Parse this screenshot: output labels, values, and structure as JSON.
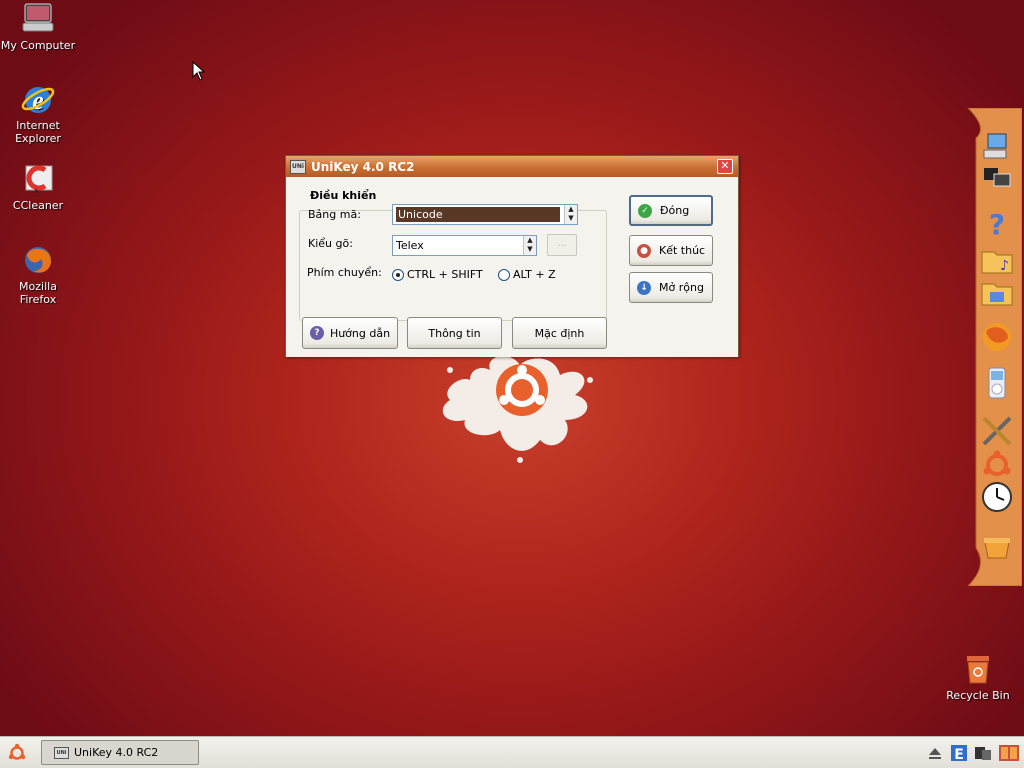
{
  "desktop": {
    "icons": [
      {
        "label_line1": "My Computer",
        "label_line2": ""
      },
      {
        "label_line1": "Internet",
        "label_line2": "Explorer"
      },
      {
        "label_line1": "CCleaner",
        "label_line2": ""
      },
      {
        "label_line1": "Mozilla Firefox",
        "label_line2": ""
      },
      {
        "label_line1": "Recycle Bin",
        "label_line2": ""
      }
    ]
  },
  "window": {
    "title": "UniKey 4.0 RC2",
    "app_icon_text": "UNi",
    "close_glyph": "✕",
    "group_title": "Điều khiển",
    "charset_label": "Bảng mã:",
    "charset_value": "Unicode",
    "input_method_label": "Kiểu gõ:",
    "input_method_value": "Telex",
    "more_button": "...",
    "switch_label": "Phím chuyển:",
    "switch_options": [
      {
        "label": "CTRL + SHIFT",
        "selected": true
      },
      {
        "label": "ALT + Z",
        "selected": false
      }
    ],
    "buttons": {
      "close": "Đóng",
      "exit": "Kết thúc",
      "expand": "Mở rộng",
      "help": "Hướng dẫn",
      "info": "Thông tin",
      "default": "Mặc định"
    }
  },
  "taskbar": {
    "task_title": "UniKey 4.0 RC2",
    "task_icon_text": "UNi"
  },
  "colors": {
    "accent": "#c96f33",
    "wallpaper": "#b0251c",
    "selection": "#5a3826"
  }
}
